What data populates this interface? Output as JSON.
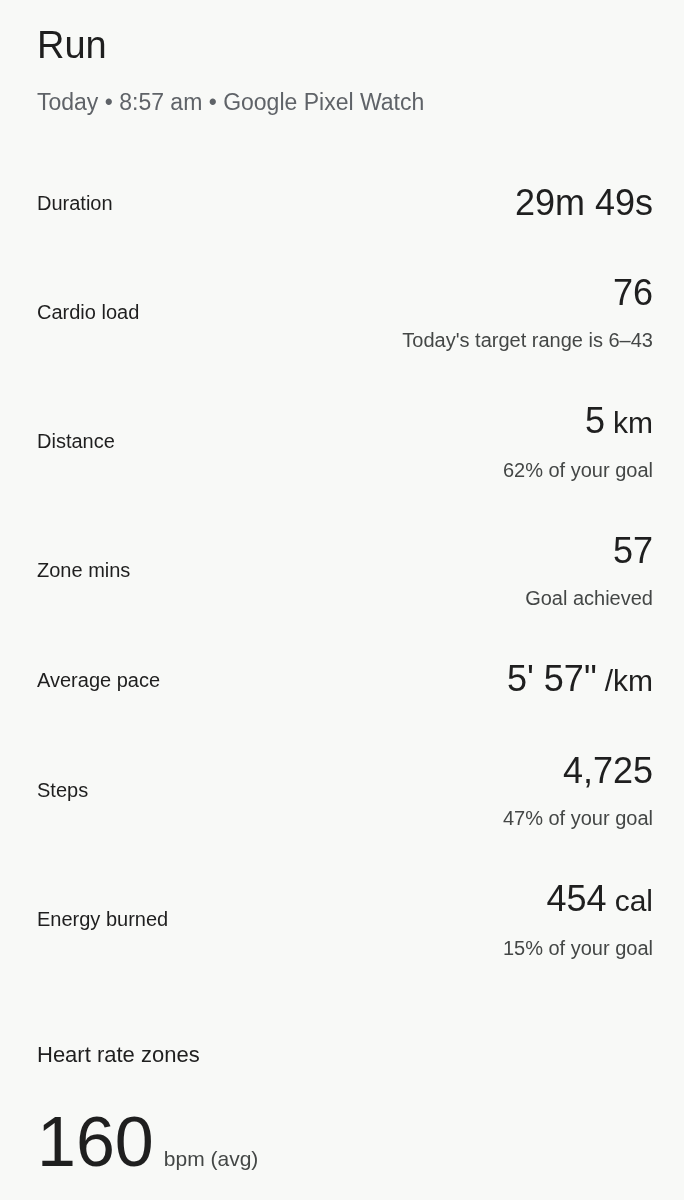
{
  "header": {
    "title": "Run",
    "subtitle": "Today • 8:57 am • Google Pixel Watch"
  },
  "stats": [
    {
      "label": "Duration",
      "value": "29m 49s"
    },
    {
      "label": "Cardio load",
      "value": "76",
      "note": "Today's target range is 6–43"
    },
    {
      "label": "Distance",
      "value": "5",
      "unit": "km",
      "note": "62% of your goal"
    },
    {
      "label": "Zone mins",
      "value": "57",
      "note": "Goal achieved"
    },
    {
      "label": "Average pace",
      "value": "5' 57\"",
      "unit": "/km"
    },
    {
      "label": "Steps",
      "value": "4,725",
      "note": "47% of your goal"
    },
    {
      "label": "Energy burned",
      "value": "454",
      "unit": "cal",
      "note": "15% of your goal"
    }
  ],
  "heart_rate": {
    "heading": "Heart rate zones",
    "value": "160",
    "unit": "bpm (avg)"
  }
}
